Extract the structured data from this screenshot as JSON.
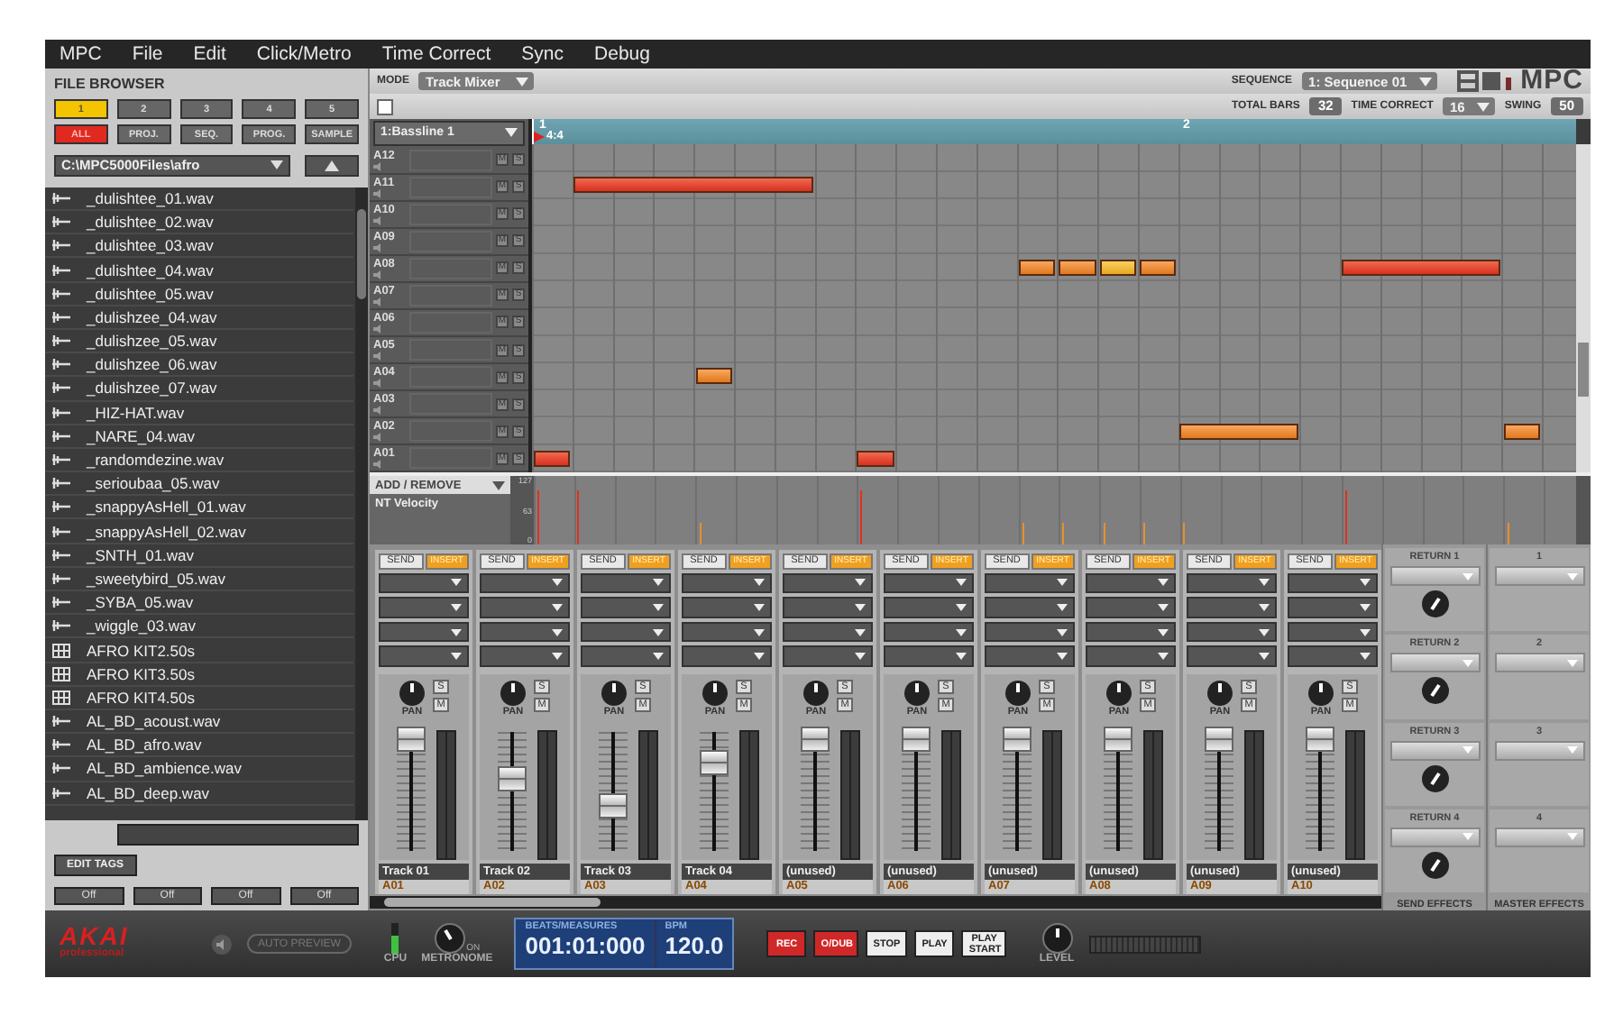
{
  "menu": [
    "MPC",
    "File",
    "Edit",
    "Click/Metro",
    "Time Correct",
    "Sync",
    "Debug"
  ],
  "file_browser": {
    "title": "FILE BROWSER",
    "slots": [
      {
        "label": "1",
        "selected": true
      },
      {
        "label": "2",
        "selected": false
      },
      {
        "label": "3",
        "selected": false
      },
      {
        "label": "4",
        "selected": false
      },
      {
        "label": "5",
        "selected": false
      }
    ],
    "filters": [
      {
        "label": "ALL",
        "selected": true
      },
      {
        "label": "PROJ.",
        "selected": false
      },
      {
        "label": "SEQ.",
        "selected": false
      },
      {
        "label": "PROG.",
        "selected": false
      },
      {
        "label": "SAMPLE",
        "selected": false
      }
    ],
    "path": "C:\\MPC5000Files\\afro",
    "files": [
      {
        "name": "_dulishtee_01.wav",
        "kind": "audio"
      },
      {
        "name": "_dulishtee_02.wav",
        "kind": "audio"
      },
      {
        "name": "_dulishtee_03.wav",
        "kind": "audio"
      },
      {
        "name": "_dulishtee_04.wav",
        "kind": "audio"
      },
      {
        "name": "_dulishtee_05.wav",
        "kind": "audio"
      },
      {
        "name": "_dulishzee_04.wav",
        "kind": "audio"
      },
      {
        "name": "_dulishzee_05.wav",
        "kind": "audio"
      },
      {
        "name": "_dulishzee_06.wav",
        "kind": "audio"
      },
      {
        "name": "_dulishzee_07.wav",
        "kind": "audio"
      },
      {
        "name": "_HIZ-HAT.wav",
        "kind": "audio"
      },
      {
        "name": "_NARE_04.wav",
        "kind": "audio"
      },
      {
        "name": "_randomdezine.wav",
        "kind": "audio"
      },
      {
        "name": "_serioubaa_05.wav",
        "kind": "audio"
      },
      {
        "name": "_snappyAsHell_01.wav",
        "kind": "audio"
      },
      {
        "name": "_snappyAsHell_02.wav",
        "kind": "audio"
      },
      {
        "name": "_SNTH_01.wav",
        "kind": "audio"
      },
      {
        "name": "_sweetybird_05.wav",
        "kind": "audio"
      },
      {
        "name": "_SYBA_05.wav",
        "kind": "audio"
      },
      {
        "name": "_wiggle_03.wav",
        "kind": "audio"
      },
      {
        "name": "AFRO KIT2.50s",
        "kind": "kit"
      },
      {
        "name": "AFRO KIT3.50s",
        "kind": "kit"
      },
      {
        "name": "AFRO KIT4.50s",
        "kind": "kit"
      },
      {
        "name": "AL_BD_acoust.wav",
        "kind": "audio"
      },
      {
        "name": "AL_BD_afro.wav",
        "kind": "audio"
      },
      {
        "name": "AL_BD_ambience.wav",
        "kind": "audio"
      },
      {
        "name": "AL_BD_deep.wav",
        "kind": "audio"
      }
    ],
    "edit_tags": "EDIT TAGS",
    "tag_buttons": [
      "Off",
      "Off",
      "Off",
      "Off"
    ]
  },
  "header": {
    "mode_label": "MODE",
    "mode": "Track Mixer",
    "sequence_label": "SEQUENCE",
    "sequence": "1: Sequence 01",
    "logo": "MPC",
    "total_bars_label": "TOTAL BARS",
    "total_bars": "32",
    "time_correct_label": "TIME CORRECT",
    "time_correct": "16",
    "swing_label": "SWING",
    "swing": "50"
  },
  "roll": {
    "track": "1:Bassline 1",
    "bar_markers": [
      "1",
      "2"
    ],
    "time_signature": "4:4",
    "pads": [
      {
        "name": "A12",
        "mute": "M",
        "solo": "S"
      },
      {
        "name": "A11",
        "mute": "M",
        "solo": "S"
      },
      {
        "name": "A10",
        "mute": "M",
        "solo": "S"
      },
      {
        "name": "A09",
        "mute": "M",
        "solo": "S"
      },
      {
        "name": "A08",
        "mute": "M",
        "solo": "S"
      },
      {
        "name": "A07",
        "mute": "M",
        "solo": "S"
      },
      {
        "name": "A06",
        "mute": "M",
        "solo": "S"
      },
      {
        "name": "A05",
        "mute": "M",
        "solo": "S"
      },
      {
        "name": "A04",
        "mute": "M",
        "solo": "S"
      },
      {
        "name": "A03",
        "mute": "M",
        "solo": "S"
      },
      {
        "name": "A02",
        "mute": "M",
        "solo": "S"
      },
      {
        "name": "A01",
        "mute": "M",
        "solo": "S"
      }
    ]
  },
  "velocity": {
    "menu": "ADD / REMOVE",
    "lane": "NT Velocity",
    "axis": [
      "127",
      "63",
      "0"
    ]
  },
  "mixer": {
    "channels": [
      {
        "name": "Track 01",
        "pad": "A01",
        "send": "SEND",
        "insert": "INSERT",
        "insert_on": true,
        "pan": "PAN",
        "solo": "S",
        "mute": "M",
        "level": 0.95
      },
      {
        "name": "Track 02",
        "pad": "A02",
        "send": "SEND",
        "insert": "INSERT",
        "insert_on": true,
        "pan": "PAN",
        "solo": "S",
        "mute": "M",
        "level": 0.6
      },
      {
        "name": "Track 03",
        "pad": "A03",
        "send": "SEND",
        "insert": "INSERT",
        "insert_on": true,
        "pan": "PAN",
        "solo": "S",
        "mute": "M",
        "level": 0.35
      },
      {
        "name": "Track 04",
        "pad": "A04",
        "send": "SEND",
        "insert": "INSERT",
        "insert_on": true,
        "pan": "PAN",
        "solo": "S",
        "mute": "M",
        "level": 0.75
      },
      {
        "name": "(unused)",
        "pad": "A05",
        "send": "SEND",
        "insert": "INSERT",
        "insert_on": true,
        "pan": "PAN",
        "solo": "S",
        "mute": "M",
        "level": 0.95
      },
      {
        "name": "(unused)",
        "pad": "A06",
        "send": "SEND",
        "insert": "INSERT",
        "insert_on": true,
        "pan": "PAN",
        "solo": "S",
        "mute": "M",
        "level": 0.95
      },
      {
        "name": "(unused)",
        "pad": "A07",
        "send": "SEND",
        "insert": "INSERT",
        "insert_on": true,
        "pan": "PAN",
        "solo": "S",
        "mute": "M",
        "level": 0.95
      },
      {
        "name": "(unused)",
        "pad": "A08",
        "send": "SEND",
        "insert": "INSERT",
        "insert_on": true,
        "pan": "PAN",
        "solo": "S",
        "mute": "M",
        "level": 0.95
      },
      {
        "name": "(unused)",
        "pad": "A09",
        "send": "SEND",
        "insert": "INSERT",
        "insert_on": true,
        "pan": "PAN",
        "solo": "S",
        "mute": "M",
        "level": 0.95
      },
      {
        "name": "(unused)",
        "pad": "A10",
        "send": "SEND",
        "insert": "INSERT",
        "insert_on": true,
        "pan": "PAN",
        "solo": "S",
        "mute": "M",
        "level": 0.95
      }
    ],
    "returns": [
      "RETURN 1",
      "RETURN 2",
      "RETURN 3",
      "RETURN 4"
    ],
    "send_effects": "SEND EFFECTS",
    "masters": [
      "1",
      "2",
      "3",
      "4"
    ],
    "master_effects": "MASTER EFFECTS"
  },
  "transport": {
    "brand": "AKAI",
    "brand_sub": "professional",
    "auto_preview": "AUTO PREVIEW",
    "cpu_label": "CPU",
    "cpu": {
      "level": 0.6
    },
    "metronome_label": "METRONOME",
    "metronome_state": "ON",
    "position_label": "BEATS/MEASURES",
    "position": "001:01:000",
    "bpm_label": "BPM",
    "bpm": "120.0",
    "buttons": [
      {
        "label": "REC",
        "kind": "record"
      },
      {
        "label": "O/DUB",
        "kind": "record"
      },
      {
        "label": "STOP",
        "kind": "plain"
      },
      {
        "label": "PLAY",
        "kind": "plain"
      },
      {
        "label": "PLAY START",
        "kind": "plain"
      }
    ],
    "level_label": "LEVEL"
  }
}
